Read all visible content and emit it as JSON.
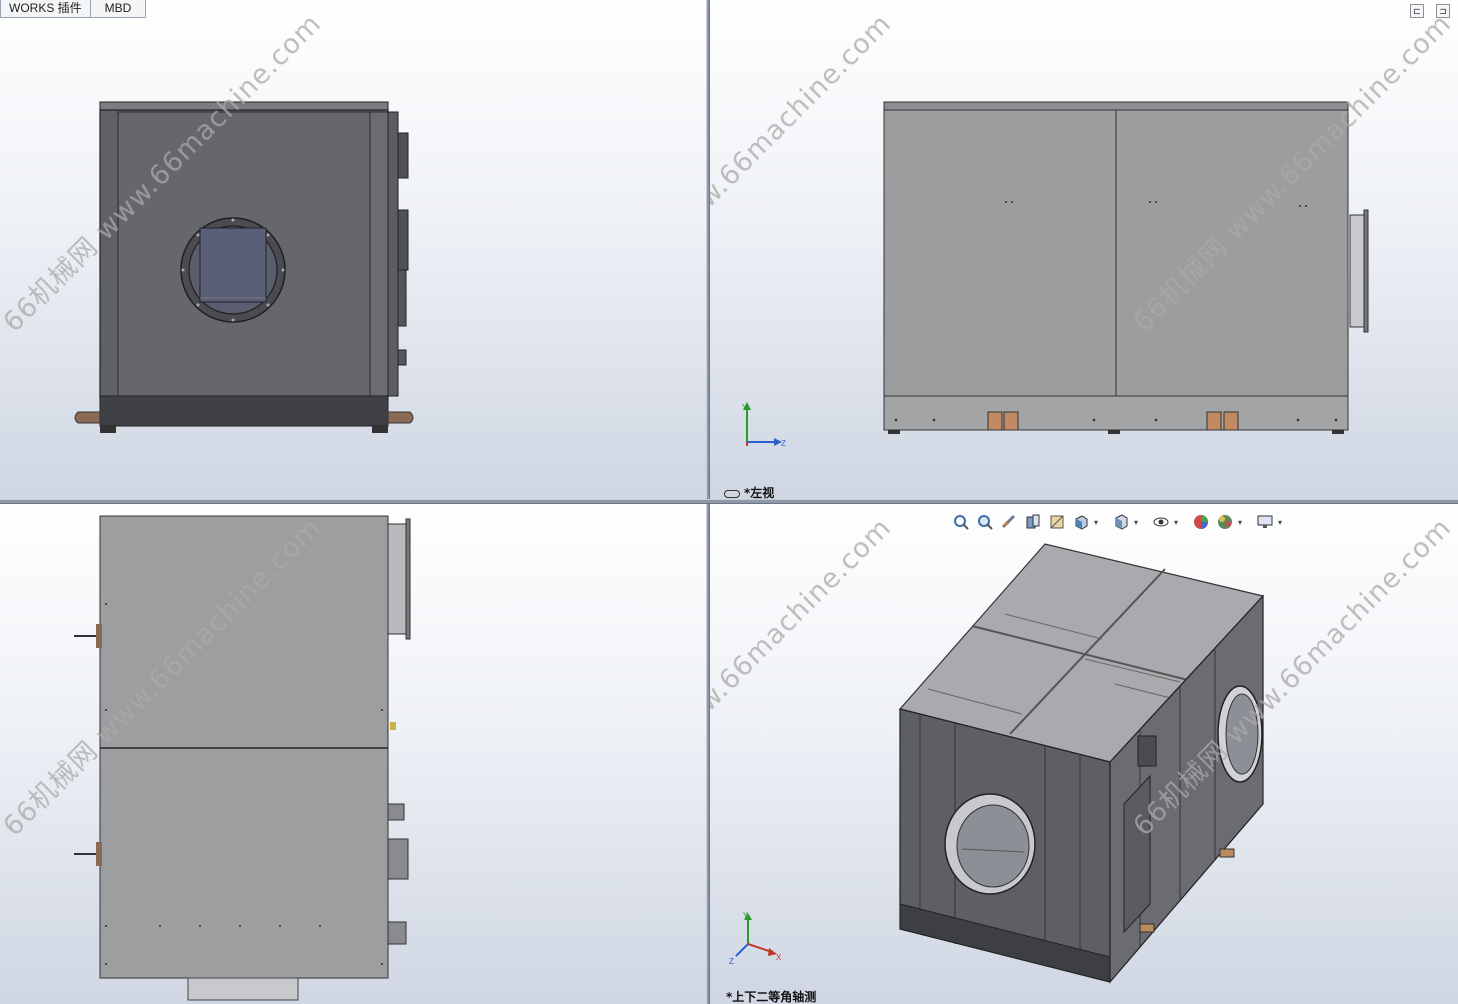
{
  "command_tabs": [
    {
      "label": "WORKS 插件"
    },
    {
      "label": "MBD"
    }
  ],
  "watermark": {
    "text": "66机械网 www.66machine.com"
  },
  "views": {
    "top_right": {
      "label": "*左视"
    },
    "bottom_right": {
      "label": "*上下二等角轴测"
    }
  },
  "triad": {
    "top_right": {
      "y": "Y",
      "z": "Z"
    },
    "bottom_right": {
      "y": "Y",
      "x": "X",
      "z": "Z"
    }
  },
  "window_buttons": {
    "restore": "⊏",
    "maximize": "⊐"
  },
  "heads_up_toolbar": [
    {
      "icon": "zoom-to-fit-icon"
    },
    {
      "icon": "zoom-to-area-icon"
    },
    {
      "icon": "previous-view-icon"
    },
    {
      "icon": "section-view-icon"
    },
    {
      "icon": "dynamic-annotation-icon"
    },
    {
      "icon": "view-orientation-icon",
      "dropdown": true
    },
    {
      "icon": "display-style-icon",
      "dropdown": true
    },
    {
      "icon": "hide-show-items-icon",
      "dropdown": true
    },
    {
      "icon": "edit-appearance-icon"
    },
    {
      "icon": "apply-scene-icon",
      "dropdown": true
    },
    {
      "icon": "view-settings-icon",
      "dropdown": true
    }
  ],
  "colors": {
    "panel_dark": "#5e6066",
    "panel_light": "#9d9ea0",
    "bracket": "#8a6a55",
    "viewport_top": "#ffffff",
    "viewport_bottom": "#cfd6e2"
  }
}
